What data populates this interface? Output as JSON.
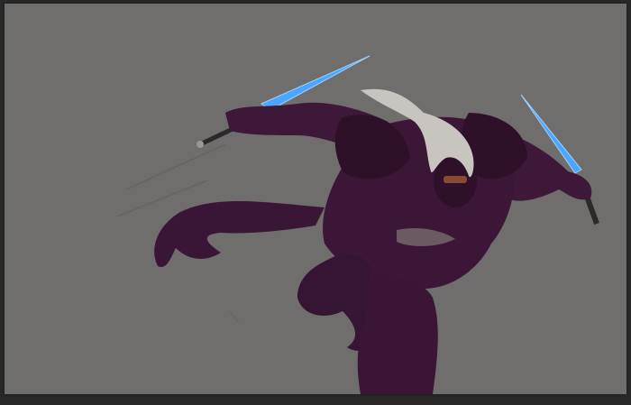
{
  "colors": {
    "workspace": "#282828",
    "canvas": "#6f6e6c",
    "armor": "#3d1838",
    "armor_shadow": "#26101f",
    "blade": "#4aa6ff",
    "hair": "#c8c4bf"
  },
  "artwork": {
    "subject": "ninja-warrior-with-twin-blades"
  }
}
